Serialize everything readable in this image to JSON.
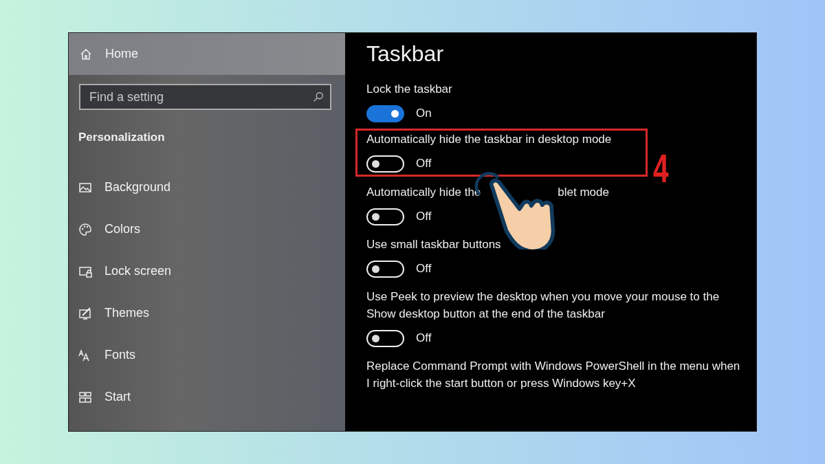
{
  "sidebar": {
    "home": "Home",
    "search": {
      "placeholder": "Find a setting"
    },
    "section": "Personalization",
    "items": [
      {
        "label": "Background"
      },
      {
        "label": "Colors"
      },
      {
        "label": "Lock screen"
      },
      {
        "label": "Themes"
      },
      {
        "label": "Fonts"
      },
      {
        "label": "Start"
      }
    ]
  },
  "content": {
    "title": "Taskbar",
    "settings": [
      {
        "kind": "toggle",
        "label": [
          "Lock the taskbar"
        ],
        "on": true,
        "state": "On"
      },
      {
        "kind": "toggle",
        "label": [
          "Automatically hide the taskbar in desktop mode"
        ],
        "on": false,
        "state": "Off",
        "highlighted": true
      },
      {
        "kind": "toggle",
        "label": [
          "Automatically hide the",
          "blet mode"
        ],
        "on": false,
        "state": "Off"
      },
      {
        "kind": "toggle",
        "label": [
          "Use small taskbar buttons"
        ],
        "on": false,
        "state": "Off"
      },
      {
        "kind": "toggle",
        "label": [
          "Use Peek to preview the desktop when you move your mouse to the Show desktop button at the end of the taskbar"
        ],
        "on": false,
        "state": "Off"
      },
      {
        "kind": "text",
        "label": [
          "Replace Command Prompt with Windows PowerShell in the menu when I right-click the start button or press Windows key+X"
        ]
      }
    ]
  },
  "annotation": {
    "step_number": "4"
  }
}
